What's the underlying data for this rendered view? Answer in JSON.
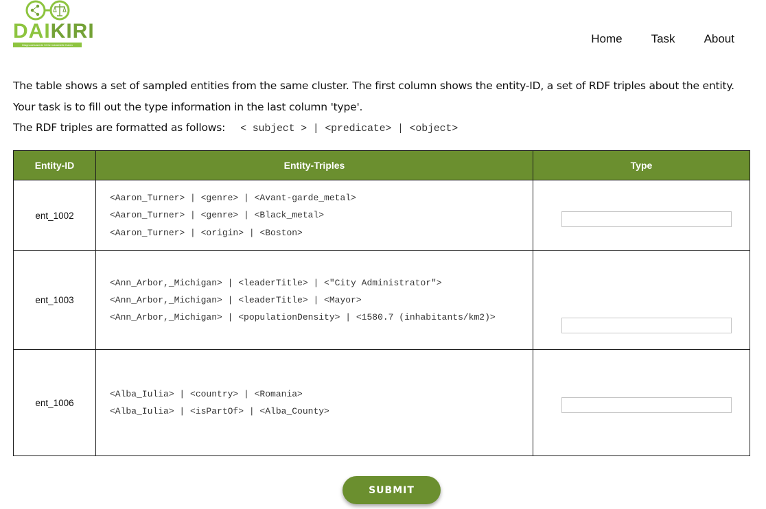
{
  "brand": {
    "name_part1": "DAI",
    "name_part2": "KIRI",
    "tagline": "Diagnosebasierte KI für industrielle Daten"
  },
  "nav": {
    "items": [
      {
        "label": "Home"
      },
      {
        "label": "Task"
      },
      {
        "label": "About"
      }
    ]
  },
  "instructions": {
    "line1": "The table shows a set of sampled entities from the same cluster. The first column shows the entity-ID, a set of RDF triples about the entity.",
    "line2": "Your task is to fill out the type information in the last column 'type'.",
    "line3": "The RDF triples are formatted as follows:",
    "format": "< subject > | <predicate> | <object>"
  },
  "table": {
    "headers": [
      "Entity-ID",
      "Entity-Triples",
      "Type"
    ],
    "rows": [
      {
        "id": "ent_1002",
        "triples": [
          "<Aaron_Turner> | <genre> | <Avant-garde_metal>",
          "<Aaron_Turner> | <genre> | <Black_metal>",
          "<Aaron_Turner> | <origin> | <Boston>"
        ],
        "type_value": ""
      },
      {
        "id": "ent_1003",
        "triples": [
          "<Ann_Arbor,_Michigan> | <leaderTitle> | <\"City Administrator\">",
          "<Ann_Arbor,_Michigan> | <leaderTitle> | <Mayor>",
          "<Ann_Arbor,_Michigan> | <populationDensity> | <1580.7 (inhabitants/km2)>"
        ],
        "type_value": ""
      },
      {
        "id": "ent_1006",
        "triples": [
          "<Alba_Iulia> | <country> | <Romania>",
          "<Alba_Iulia> | <isPartOf> | <Alba_County>"
        ],
        "type_value": ""
      }
    ]
  },
  "submit_label": "SUBMIT",
  "colors": {
    "header_green": "#6b8f2f",
    "logo_green_light": "#8dc43f",
    "logo_green_dark": "#74a237"
  }
}
